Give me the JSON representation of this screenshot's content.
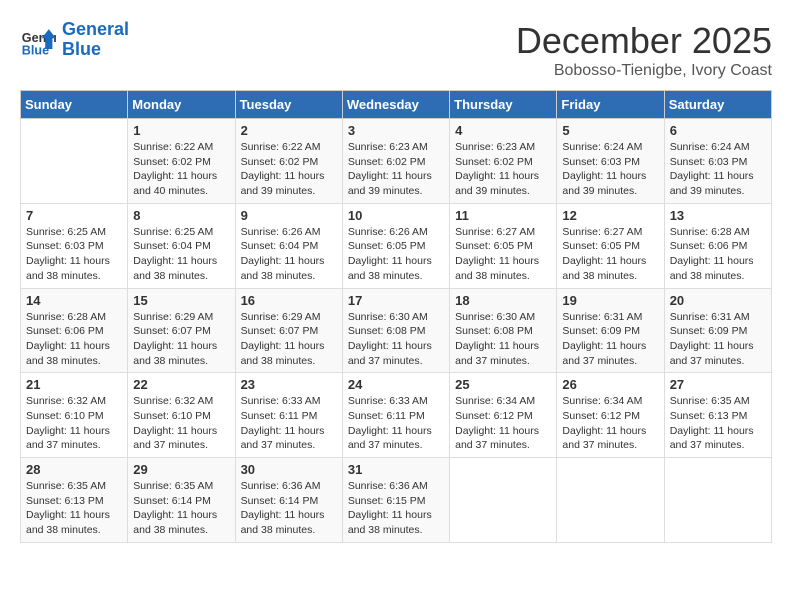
{
  "header": {
    "logo_line1": "General",
    "logo_line2": "Blue",
    "month": "December 2025",
    "location": "Bobosso-Tienigbe, Ivory Coast"
  },
  "weekdays": [
    "Sunday",
    "Monday",
    "Tuesday",
    "Wednesday",
    "Thursday",
    "Friday",
    "Saturday"
  ],
  "weeks": [
    [
      {
        "day": "",
        "info": ""
      },
      {
        "day": "1",
        "info": "Sunrise: 6:22 AM\nSunset: 6:02 PM\nDaylight: 11 hours\nand 40 minutes."
      },
      {
        "day": "2",
        "info": "Sunrise: 6:22 AM\nSunset: 6:02 PM\nDaylight: 11 hours\nand 39 minutes."
      },
      {
        "day": "3",
        "info": "Sunrise: 6:23 AM\nSunset: 6:02 PM\nDaylight: 11 hours\nand 39 minutes."
      },
      {
        "day": "4",
        "info": "Sunrise: 6:23 AM\nSunset: 6:02 PM\nDaylight: 11 hours\nand 39 minutes."
      },
      {
        "day": "5",
        "info": "Sunrise: 6:24 AM\nSunset: 6:03 PM\nDaylight: 11 hours\nand 39 minutes."
      },
      {
        "day": "6",
        "info": "Sunrise: 6:24 AM\nSunset: 6:03 PM\nDaylight: 11 hours\nand 39 minutes."
      }
    ],
    [
      {
        "day": "7",
        "info": "Sunrise: 6:25 AM\nSunset: 6:03 PM\nDaylight: 11 hours\nand 38 minutes."
      },
      {
        "day": "8",
        "info": "Sunrise: 6:25 AM\nSunset: 6:04 PM\nDaylight: 11 hours\nand 38 minutes."
      },
      {
        "day": "9",
        "info": "Sunrise: 6:26 AM\nSunset: 6:04 PM\nDaylight: 11 hours\nand 38 minutes."
      },
      {
        "day": "10",
        "info": "Sunrise: 6:26 AM\nSunset: 6:05 PM\nDaylight: 11 hours\nand 38 minutes."
      },
      {
        "day": "11",
        "info": "Sunrise: 6:27 AM\nSunset: 6:05 PM\nDaylight: 11 hours\nand 38 minutes."
      },
      {
        "day": "12",
        "info": "Sunrise: 6:27 AM\nSunset: 6:05 PM\nDaylight: 11 hours\nand 38 minutes."
      },
      {
        "day": "13",
        "info": "Sunrise: 6:28 AM\nSunset: 6:06 PM\nDaylight: 11 hours\nand 38 minutes."
      }
    ],
    [
      {
        "day": "14",
        "info": "Sunrise: 6:28 AM\nSunset: 6:06 PM\nDaylight: 11 hours\nand 38 minutes."
      },
      {
        "day": "15",
        "info": "Sunrise: 6:29 AM\nSunset: 6:07 PM\nDaylight: 11 hours\nand 38 minutes."
      },
      {
        "day": "16",
        "info": "Sunrise: 6:29 AM\nSunset: 6:07 PM\nDaylight: 11 hours\nand 38 minutes."
      },
      {
        "day": "17",
        "info": "Sunrise: 6:30 AM\nSunset: 6:08 PM\nDaylight: 11 hours\nand 37 minutes."
      },
      {
        "day": "18",
        "info": "Sunrise: 6:30 AM\nSunset: 6:08 PM\nDaylight: 11 hours\nand 37 minutes."
      },
      {
        "day": "19",
        "info": "Sunrise: 6:31 AM\nSunset: 6:09 PM\nDaylight: 11 hours\nand 37 minutes."
      },
      {
        "day": "20",
        "info": "Sunrise: 6:31 AM\nSunset: 6:09 PM\nDaylight: 11 hours\nand 37 minutes."
      }
    ],
    [
      {
        "day": "21",
        "info": "Sunrise: 6:32 AM\nSunset: 6:10 PM\nDaylight: 11 hours\nand 37 minutes."
      },
      {
        "day": "22",
        "info": "Sunrise: 6:32 AM\nSunset: 6:10 PM\nDaylight: 11 hours\nand 37 minutes."
      },
      {
        "day": "23",
        "info": "Sunrise: 6:33 AM\nSunset: 6:11 PM\nDaylight: 11 hours\nand 37 minutes."
      },
      {
        "day": "24",
        "info": "Sunrise: 6:33 AM\nSunset: 6:11 PM\nDaylight: 11 hours\nand 37 minutes."
      },
      {
        "day": "25",
        "info": "Sunrise: 6:34 AM\nSunset: 6:12 PM\nDaylight: 11 hours\nand 37 minutes."
      },
      {
        "day": "26",
        "info": "Sunrise: 6:34 AM\nSunset: 6:12 PM\nDaylight: 11 hours\nand 37 minutes."
      },
      {
        "day": "27",
        "info": "Sunrise: 6:35 AM\nSunset: 6:13 PM\nDaylight: 11 hours\nand 37 minutes."
      }
    ],
    [
      {
        "day": "28",
        "info": "Sunrise: 6:35 AM\nSunset: 6:13 PM\nDaylight: 11 hours\nand 38 minutes."
      },
      {
        "day": "29",
        "info": "Sunrise: 6:35 AM\nSunset: 6:14 PM\nDaylight: 11 hours\nand 38 minutes."
      },
      {
        "day": "30",
        "info": "Sunrise: 6:36 AM\nSunset: 6:14 PM\nDaylight: 11 hours\nand 38 minutes."
      },
      {
        "day": "31",
        "info": "Sunrise: 6:36 AM\nSunset: 6:15 PM\nDaylight: 11 hours\nand 38 minutes."
      },
      {
        "day": "",
        "info": ""
      },
      {
        "day": "",
        "info": ""
      },
      {
        "day": "",
        "info": ""
      }
    ]
  ]
}
